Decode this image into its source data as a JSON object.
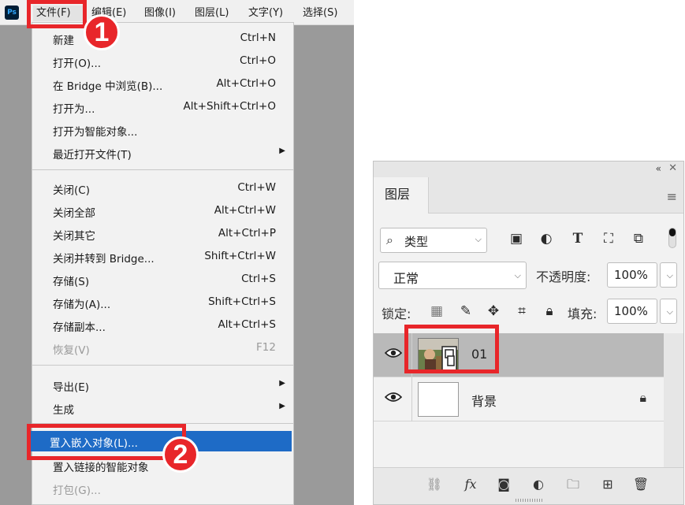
{
  "app": {
    "logo_text": "Ps"
  },
  "menubar": {
    "items": [
      "文件(F)",
      "编辑(E)",
      "图像(I)",
      "图层(L)",
      "文字(Y)",
      "选择(S)"
    ]
  },
  "file_menu": {
    "groups": [
      [
        {
          "label": "新建",
          "shortcut": "Ctrl+N"
        },
        {
          "label": "打开(O)...",
          "shortcut": "Ctrl+O"
        },
        {
          "label": "在 Bridge 中浏览(B)...",
          "shortcut": "Alt+Ctrl+O"
        },
        {
          "label": "打开为...",
          "shortcut": "Alt+Shift+Ctrl+O"
        },
        {
          "label": "打开为智能对象...",
          "shortcut": ""
        },
        {
          "label": "最近打开文件(T)",
          "shortcut": "",
          "submenu": true
        }
      ],
      [
        {
          "label": "关闭(C)",
          "shortcut": "Ctrl+W"
        },
        {
          "label": "关闭全部",
          "shortcut": "Alt+Ctrl+W"
        },
        {
          "label": "关闭其它",
          "shortcut": "Alt+Ctrl+P"
        },
        {
          "label": "关闭并转到 Bridge...",
          "shortcut": "Shift+Ctrl+W"
        },
        {
          "label": "存储(S)",
          "shortcut": "Ctrl+S"
        },
        {
          "label": "存储为(A)...",
          "shortcut": "Shift+Ctrl+S"
        },
        {
          "label": "存储副本...",
          "shortcut": "Alt+Ctrl+S"
        },
        {
          "label": "恢复(V)",
          "shortcut": "F12",
          "disabled": true
        }
      ],
      [
        {
          "label": "导出(E)",
          "shortcut": "",
          "submenu": true
        },
        {
          "label": "生成",
          "shortcut": "",
          "submenu": true
        }
      ],
      [
        {
          "label": "置入嵌入对象(L)...",
          "shortcut": "",
          "active": true
        },
        {
          "label": "置入链接的智能对象",
          "shortcut": ""
        },
        {
          "label": "打包(G)...",
          "shortcut": "",
          "disabled": true
        }
      ]
    ]
  },
  "annotations": {
    "step1": "1",
    "step2": "2",
    "highlight_color": "#e8262a"
  },
  "layers_panel": {
    "tab_label": "图层",
    "filter_label": "类型",
    "blend_mode": "正常",
    "opacity_label": "不透明度:",
    "opacity_value": "100%",
    "lock_label": "锁定:",
    "fill_label": "填充:",
    "fill_value": "100%",
    "layers": [
      {
        "name": "01",
        "selected": true,
        "thumb": "photo-smart-object"
      },
      {
        "name": "背景",
        "selected": false,
        "thumb": "white",
        "locked": true
      }
    ]
  },
  "colors": {
    "menu_active": "#1e6bc6",
    "selected_layer": "#b9b9b9",
    "canvas_gray": "#9a9a9a"
  }
}
